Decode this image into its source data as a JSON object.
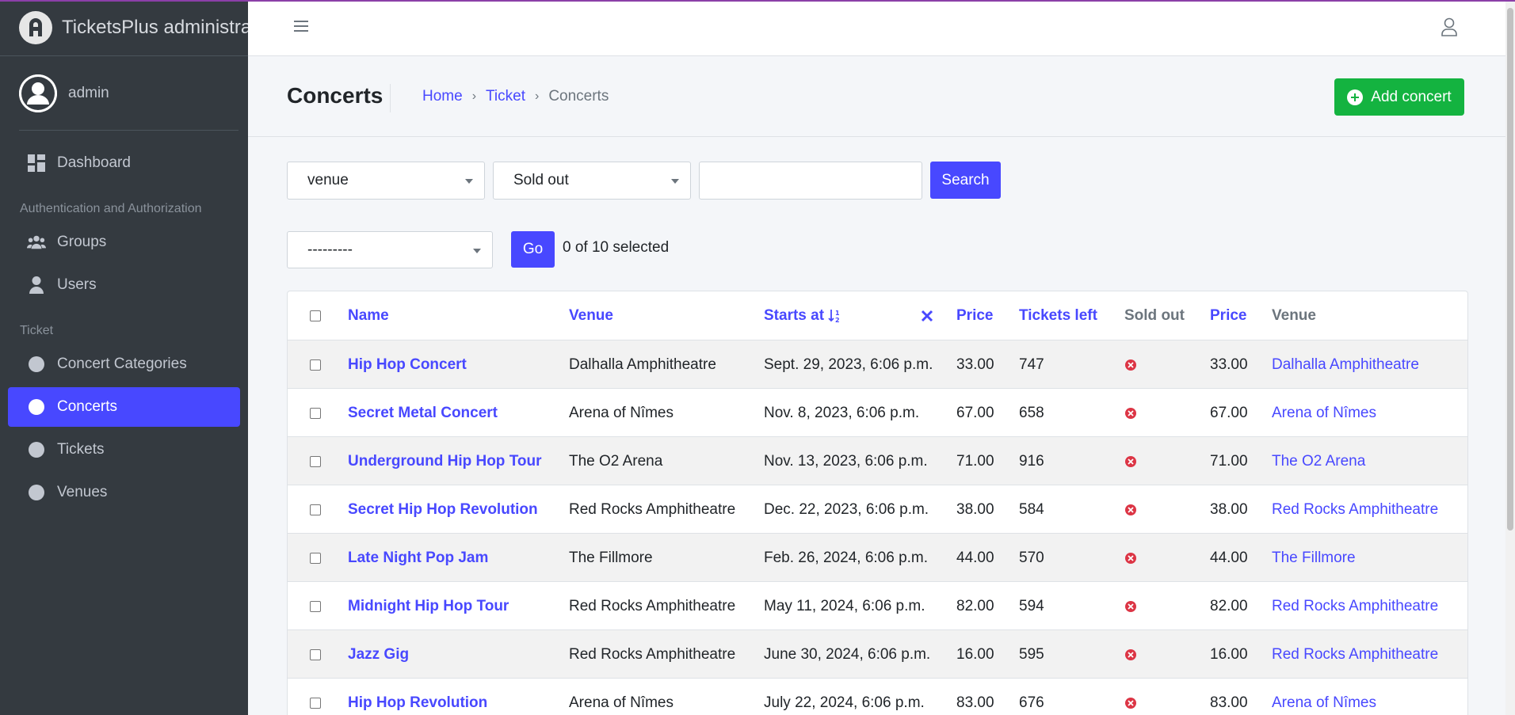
{
  "colors": {
    "accent": "#4848ff",
    "success": "#14b340",
    "danger": "#dc3545",
    "sidebar_bg": "#343a40"
  },
  "brand": {
    "title": "TicketsPlus administrat"
  },
  "user": {
    "name": "admin"
  },
  "sidebar": {
    "dashboard": "Dashboard",
    "section_auth": "Authentication and Authorization",
    "groups": "Groups",
    "users": "Users",
    "section_ticket": "Ticket",
    "concert_categories": "Concert Categories",
    "concerts": "Concerts",
    "tickets": "Tickets",
    "venues": "Venues"
  },
  "header": {
    "title": "Concerts",
    "breadcrumb": {
      "home": "Home",
      "ticket": "Ticket",
      "current": "Concerts",
      "separator": "›"
    },
    "add_button": "Add concert"
  },
  "filters": {
    "venue_select": "venue",
    "sold_out_select": "Sold out",
    "search_value": "",
    "search_button": "Search"
  },
  "actions": {
    "action_select": "---------",
    "go_button": "Go",
    "selected_text": "0 of 10 selected"
  },
  "table": {
    "columns": {
      "name": "Name",
      "venue": "Venue",
      "starts_at": "Starts at",
      "price": "Price",
      "tickets_left": "Tickets left",
      "sold_out": "Sold out",
      "price2": "Price",
      "venue2": "Venue"
    },
    "sort_icon": "sort-ascending-icon",
    "clear_sort_icon": "close-icon",
    "rows": [
      {
        "name": "Hip Hop Concert",
        "venue": "Dalhalla Amphitheatre",
        "starts_at": "Sept. 29, 2023, 6:06 p.m.",
        "price": "33.00",
        "tickets_left": "747",
        "sold_out": false,
        "price2": "33.00",
        "venue_link": "Dalhalla Amphitheatre"
      },
      {
        "name": "Secret Metal Concert",
        "venue": "Arena of Nîmes",
        "starts_at": "Nov. 8, 2023, 6:06 p.m.",
        "price": "67.00",
        "tickets_left": "658",
        "sold_out": false,
        "price2": "67.00",
        "venue_link": "Arena of Nîmes"
      },
      {
        "name": "Underground Hip Hop Tour",
        "venue": "The O2 Arena",
        "starts_at": "Nov. 13, 2023, 6:06 p.m.",
        "price": "71.00",
        "tickets_left": "916",
        "sold_out": false,
        "price2": "71.00",
        "venue_link": "The O2 Arena"
      },
      {
        "name": "Secret Hip Hop Revolution",
        "venue": "Red Rocks Amphitheatre",
        "starts_at": "Dec. 22, 2023, 6:06 p.m.",
        "price": "38.00",
        "tickets_left": "584",
        "sold_out": false,
        "price2": "38.00",
        "venue_link": "Red Rocks Amphitheatre"
      },
      {
        "name": "Late Night Pop Jam",
        "venue": "The Fillmore",
        "starts_at": "Feb. 26, 2024, 6:06 p.m.",
        "price": "44.00",
        "tickets_left": "570",
        "sold_out": false,
        "price2": "44.00",
        "venue_link": "The Fillmore"
      },
      {
        "name": "Midnight Hip Hop Tour",
        "venue": "Red Rocks Amphitheatre",
        "starts_at": "May 11, 2024, 6:06 p.m.",
        "price": "82.00",
        "tickets_left": "594",
        "sold_out": false,
        "price2": "82.00",
        "venue_link": "Red Rocks Amphitheatre"
      },
      {
        "name": "Jazz Gig",
        "venue": "Red Rocks Amphitheatre",
        "starts_at": "June 30, 2024, 6:06 p.m.",
        "price": "16.00",
        "tickets_left": "595",
        "sold_out": false,
        "price2": "16.00",
        "venue_link": "Red Rocks Amphitheatre"
      },
      {
        "name": "Hip Hop Revolution",
        "venue": "Arena of Nîmes",
        "starts_at": "July 22, 2024, 6:06 p.m.",
        "price": "83.00",
        "tickets_left": "676",
        "sold_out": false,
        "price2": "83.00",
        "venue_link": "Arena of Nîmes"
      }
    ]
  }
}
